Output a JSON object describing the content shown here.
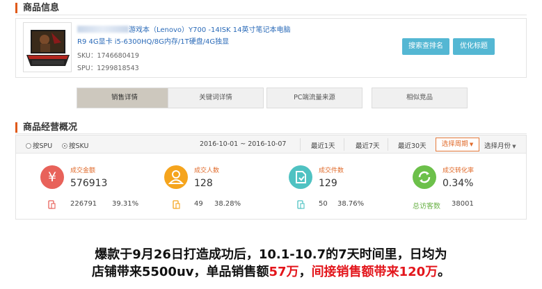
{
  "product_section": {
    "title": "商品信息"
  },
  "product": {
    "name_line1": "游戏本（Lenovo）Y700 -14ISK 14英寸笔记本电脑",
    "name_line2": "R9 4G显卡 i5-6300HQ/8G内存/1T硬盘/4G独显",
    "sku": "SKU：1746680419",
    "spu": "SPU：1299818543",
    "image_icon": "laptop-image"
  },
  "actions": {
    "rank_button": "搜索查排名",
    "optimize_button": "优化标题"
  },
  "tabs": [
    "销售详情",
    "关键词详情",
    "PC端流量来源",
    "相似竞品"
  ],
  "overview_section": {
    "title": "商品经营概况"
  },
  "filter": {
    "radio_spu": "按SPU",
    "radio_sku": "按SKU",
    "date_range": "2016-10-01 ~ 2016-10-07",
    "last_1": "最近1天",
    "last_7": "最近7天",
    "last_30": "最近30天",
    "choose_period": "选择周期",
    "choose_month": "选择月份"
  },
  "metrics": [
    {
      "icon": "yen-icon",
      "label": "成交金额",
      "value": "576913",
      "sub_value": "226791",
      "sub_pct": "39.31%",
      "color": "#e8625a"
    },
    {
      "icon": "user-icon",
      "label": "成交人数",
      "value": "128",
      "sub_value": "49",
      "sub_pct": "38.28%",
      "color": "#f5a41d"
    },
    {
      "icon": "order-icon",
      "label": "成交件数",
      "value": "129",
      "sub_value": "50",
      "sub_pct": "38.76%",
      "color": "#4fc2c2"
    },
    {
      "icon": "refresh-icon",
      "label": "成交转化率",
      "value": "0.34%",
      "sub_label": "总访客数",
      "sub_value": "38001",
      "color": "#6cc04a"
    }
  ],
  "caption": {
    "line1": "爆款于9月26日打造成功后，10.1-10.7的7天时间里，日均为",
    "line2_a": "店铺带来5500uv，单品销售额",
    "line2_b": "57万",
    "line2_c": "，",
    "line2_d": "间接销售额带来120万",
    "line2_e": "。",
    "highlight_color": "#e3151b"
  }
}
